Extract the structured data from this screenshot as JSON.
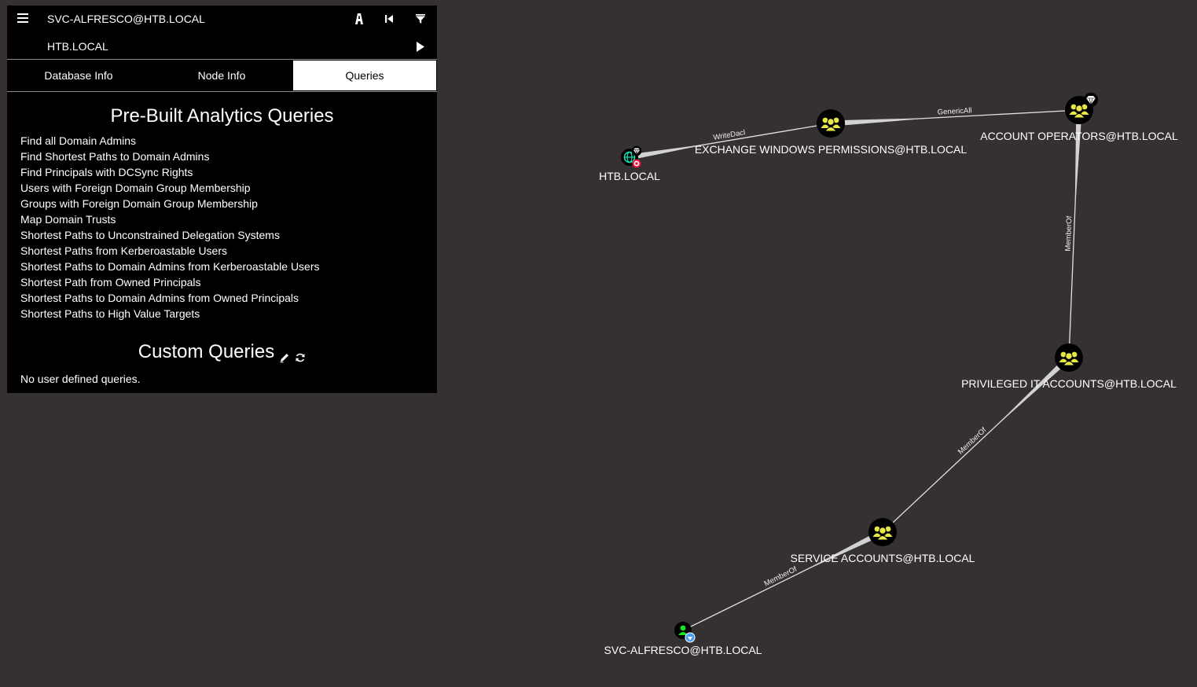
{
  "search": {
    "start_node": "SVC-ALFRESCO@HTB.LOCAL",
    "target_node": "HTB.LOCAL"
  },
  "toolbar_icons": [
    "menu-icon",
    "pathfinding-icon",
    "back-icon",
    "filter-icon",
    "play-icon"
  ],
  "tabs": [
    {
      "label": "Database Info",
      "active": false
    },
    {
      "label": "Node Info",
      "active": false
    },
    {
      "label": "Queries",
      "active": true
    }
  ],
  "prebuilt": {
    "title": "Pre-Built Analytics Queries",
    "queries": [
      "Find all Domain Admins",
      "Find Shortest Paths to Domain Admins",
      "Find Principals with DCSync Rights",
      "Users with Foreign Domain Group Membership",
      "Groups with Foreign Domain Group Membership",
      "Map Domain Trusts",
      "Shortest Paths to Unconstrained Delegation Systems",
      "Shortest Paths from Kerberoastable Users",
      "Shortest Paths to Domain Admins from Kerberoastable Users",
      "Shortest Path from Owned Principals",
      "Shortest Paths to Domain Admins from Owned Principals",
      "Shortest Paths to High Value Targets"
    ]
  },
  "custom": {
    "title": "Custom Queries",
    "empty_text": "No user defined queries."
  },
  "graph": {
    "nodes": [
      {
        "id": "domain",
        "label": "HTB.LOCAL",
        "type": "domain",
        "badges": [
          "high-value",
          "target"
        ]
      },
      {
        "id": "ewp",
        "label": "EXCHANGE WINDOWS PERMISSIONS@HTB.LOCAL",
        "type": "group",
        "badges": []
      },
      {
        "id": "ao",
        "label": "ACCOUNT OPERATORS@HTB.LOCAL",
        "type": "group",
        "badges": [
          "high-value"
        ]
      },
      {
        "id": "pit",
        "label": "PRIVILEGED IT ACCOUNTS@HTB.LOCAL",
        "type": "group",
        "badges": []
      },
      {
        "id": "sa",
        "label": "SERVICE ACCOUNTS@HTB.LOCAL",
        "type": "group",
        "badges": []
      },
      {
        "id": "svc",
        "label": "SVC-ALFRESCO@HTB.LOCAL",
        "type": "user",
        "badges": [
          "owned"
        ]
      }
    ],
    "edges": [
      {
        "from": "ewp",
        "to": "domain",
        "label": "WriteDacl"
      },
      {
        "from": "ao",
        "to": "ewp",
        "label": "GenericAll"
      },
      {
        "from": "pit",
        "to": "ao",
        "label": "MemberOf"
      },
      {
        "from": "sa",
        "to": "pit",
        "label": "MemberOf"
      },
      {
        "from": "svc",
        "to": "sa",
        "label": "MemberOf"
      }
    ]
  },
  "colors": {
    "background": "#363131",
    "panel": "#000000",
    "group_icon": "#e8e84a",
    "user_icon": "#17e625",
    "domain_icon": "#17e6b9",
    "target_badge": "#e6173d",
    "owned_badge": "#4a9ff2"
  }
}
